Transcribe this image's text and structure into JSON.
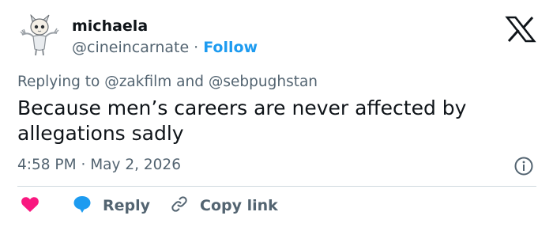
{
  "header": {
    "display_name": "michaela",
    "handle": "@cineincarnate",
    "separator": "·",
    "follow_label": "Follow"
  },
  "tweet": {
    "replying_prefix": "Replying to",
    "replying_to": [
      "@zakfilm",
      "@sebpughstan"
    ],
    "replying_joiner": "and",
    "text": "Because men’s careers are never affected by allegations sadly",
    "time": "4:58 PM",
    "date_separator": "·",
    "date": "May 2, 2026"
  },
  "actions": {
    "reply_label": "Reply",
    "copy_link_label": "Copy link"
  },
  "colors": {
    "accent": "#1d9bf0",
    "like": "#f91880",
    "muted": "#536471",
    "text": "#0f1419",
    "divider": "#cfd9de"
  },
  "icons": [
    "avatar",
    "x-logo-icon",
    "info-icon",
    "heart-icon",
    "reply-bubble-icon",
    "link-icon"
  ]
}
